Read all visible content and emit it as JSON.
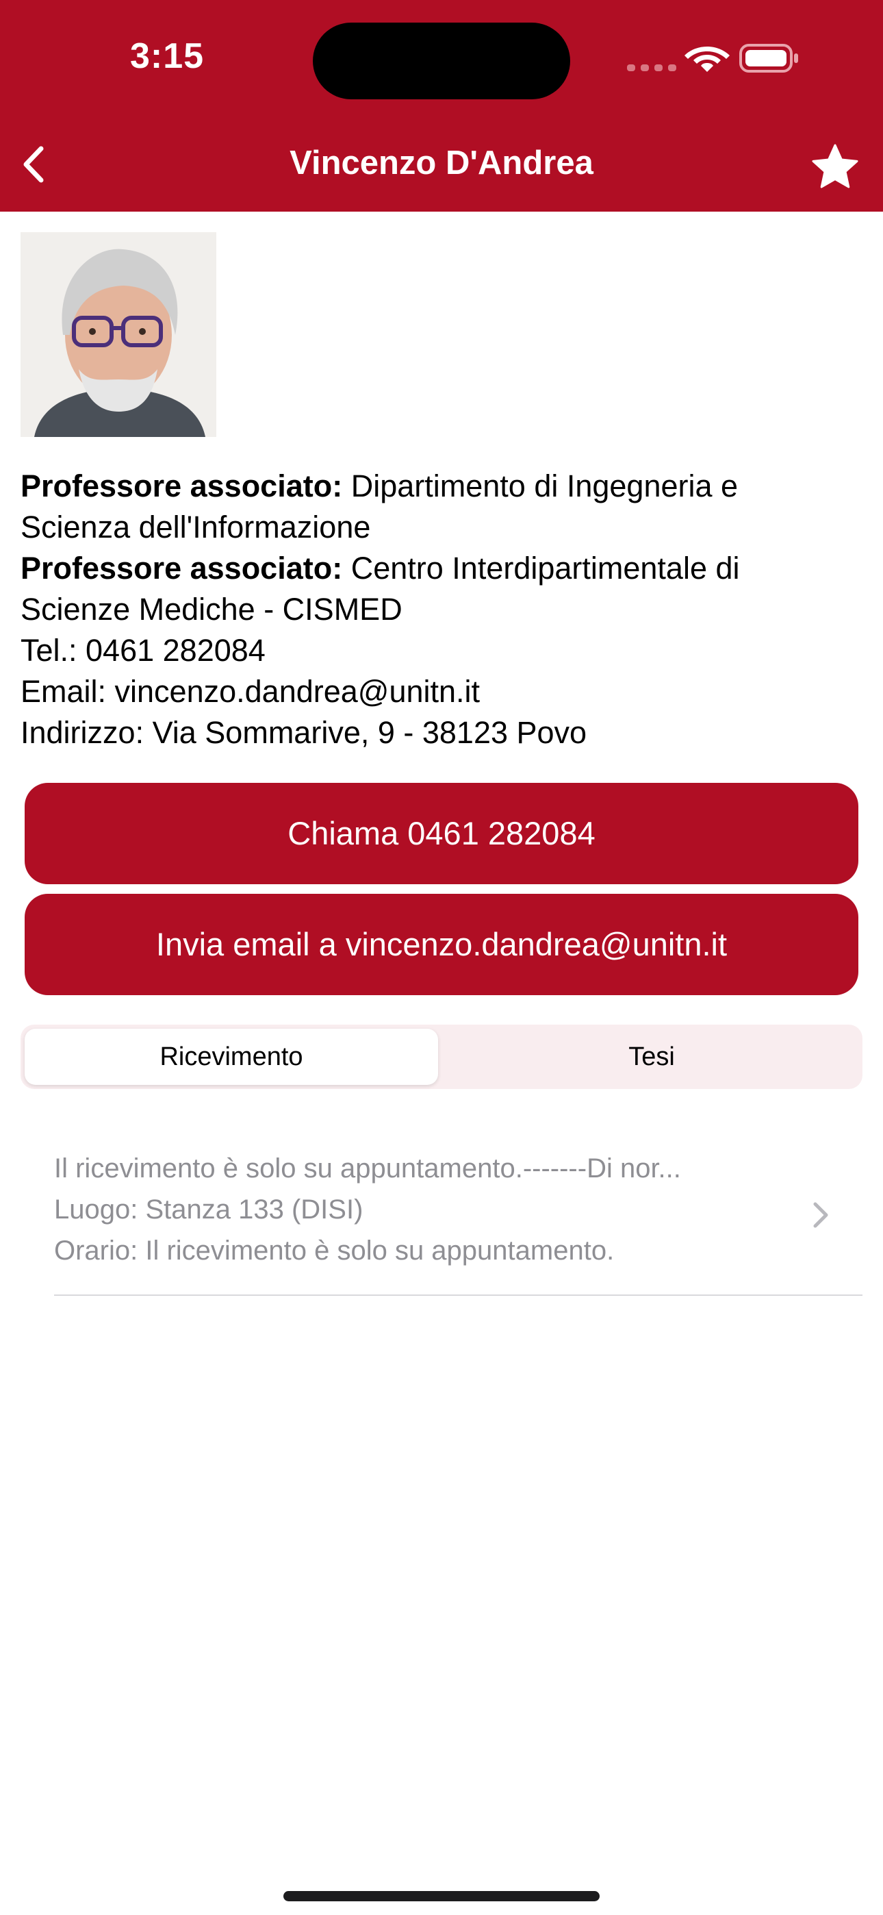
{
  "status_bar": {
    "time": "3:15"
  },
  "nav": {
    "title": "Vincenzo D'Andrea",
    "back_icon": "chevron-left-icon",
    "favorite_icon": "star-icon"
  },
  "profile": {
    "photo_icon": "profile-photo",
    "roles": [
      {
        "label": "Professore associato:",
        "line1": "Dipartimento di Ingegneria e",
        "line2": "Scienza dell'Informazione"
      },
      {
        "label": "Professore associato:",
        "line1": "Centro Interdipartimentale di",
        "line2": "Scienze Mediche - CISMED"
      }
    ],
    "phone_line": "Tel.: 0461 282084",
    "email_line": "Email: vincenzo.dandrea@unitn.it",
    "address_line": "Indirizzo: Via Sommarive, 9 - 38123 Povo"
  },
  "actions": {
    "call_label": "Chiama 0461 282084",
    "email_label": "Invia email a vincenzo.dandrea@unitn.it"
  },
  "tabs": {
    "items": [
      {
        "label": "Ricevimento",
        "selected": true
      },
      {
        "label": "Tesi",
        "selected": false
      }
    ]
  },
  "office_hours": {
    "rows": [
      {
        "note": "Il ricevimento è solo su appuntamento.-------Di nor...",
        "place": "Luogo: Stanza 133 (DISI)",
        "time": "Orario: Il ricevimento è solo su appuntamento."
      }
    ]
  },
  "colors": {
    "brand": "#B00E24",
    "segment_bg": "#F9EDEF",
    "secondary_text": "#8E8E93"
  }
}
